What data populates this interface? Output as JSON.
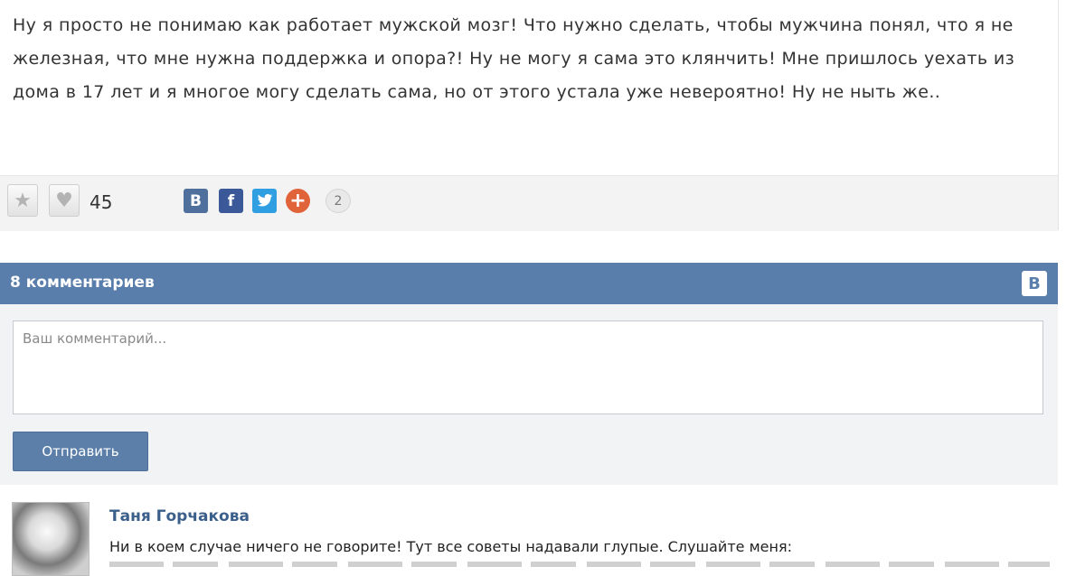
{
  "post": {
    "text": "Ну я просто не понимаю как работает мужской мозг! Что нужно сделать, чтобы мужчина понял, что я не железная, что мне нужна поддержка и опора?! Ну не могу я сама это клянчить! Мне пришлось уехать из дома в 17 лет и я многое могу сделать сама, но от этого устала уже невероятно! Ну не ныть же..",
    "likes_count": "45",
    "share_count": "2",
    "share_buttons": [
      {
        "name": "vk",
        "label": "В",
        "color": "#4f6f9d"
      },
      {
        "name": "facebook",
        "label": "f",
        "color": "#3b5998"
      },
      {
        "name": "twitter",
        "label": "🐦",
        "color": "#2f9fe2"
      },
      {
        "name": "more",
        "label": "+",
        "color": "#e0633a"
      }
    ]
  },
  "comments": {
    "title": "8 комментариев",
    "vk_badge": "В",
    "input_placeholder": "Ваш комментарий...",
    "submit_label": "Отправить",
    "first": {
      "author": "Таня Горчакова",
      "text": "Ни в коем случае ничего не говорите! Тут все советы надавали глупые. Слушайте меня:"
    }
  },
  "colors": {
    "header": "#5a7eab",
    "accent": "#3b5f8b"
  }
}
